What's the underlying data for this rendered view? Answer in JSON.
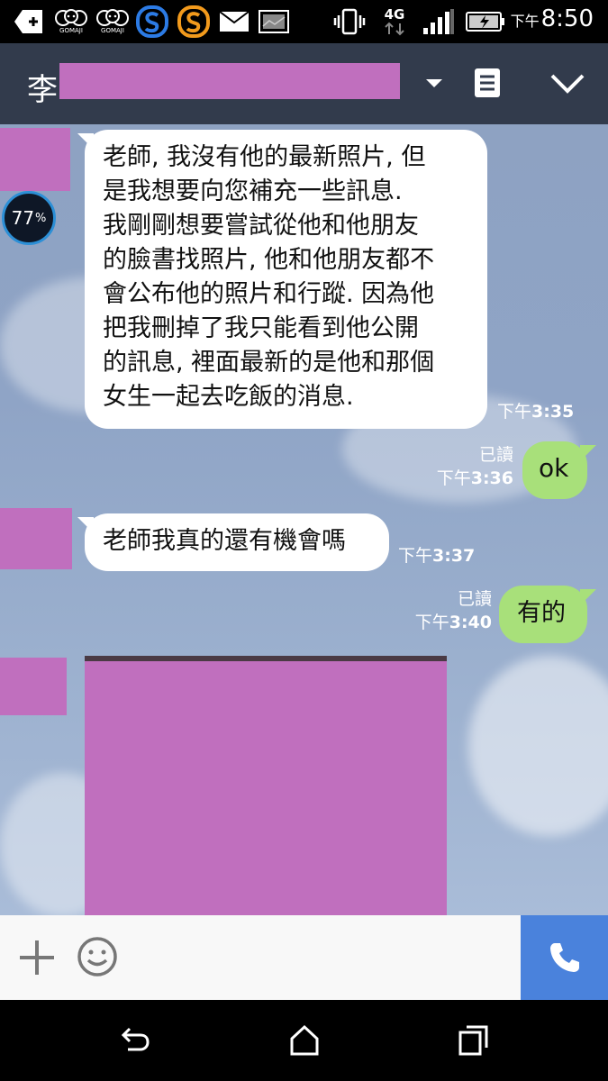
{
  "status_bar": {
    "time": "8:50",
    "ampm": "下午",
    "network": "4G",
    "icons": [
      "add-icon",
      "gomaji-icon",
      "gomaji-icon",
      "s-app-icon",
      "s-app-icon",
      "mail-icon",
      "image-icon",
      "vibrate-icon",
      "signal-icon",
      "battery-charging-icon"
    ],
    "gomaji_label": "GOMAJI"
  },
  "header": {
    "title": "李",
    "icons": [
      "dropdown-icon",
      "notes-icon",
      "chevron-down-icon"
    ]
  },
  "contact_badge": {
    "value": "77",
    "unit": "%"
  },
  "messages": [
    {
      "direction": "in",
      "lines": [
        "老師, 我沒有他的最新照片, 但",
        "是我想要向您補充一些訊息.",
        "我剛剛想要嘗試從他和他朋友",
        "的臉書找照片, 他和他朋友都不",
        "會公布他的照片和行蹤. 因為他",
        "把我刪掉了我只能看到他公開",
        "的訊息, 裡面最新的是他和那個",
        "女生一起去吃飯的消息."
      ],
      "ampm": "下午",
      "time": "3:35"
    },
    {
      "direction": "out",
      "text": "ok",
      "read": "已讀",
      "ampm": "下午",
      "time": "3:36"
    },
    {
      "direction": "in",
      "text": "老師我真的還有機會嗎",
      "ampm": "下午",
      "time": "3:37"
    },
    {
      "direction": "out",
      "text": "有的",
      "read": "已讀",
      "ampm": "下午",
      "time": "3:40"
    }
  ],
  "colors": {
    "header_bg": "#323b4c",
    "out_bubble": "#a8e07a",
    "call_button": "#4a82dc",
    "redaction": "#c06fbe"
  },
  "input_bar": {
    "icons": [
      "plus-icon",
      "emoji-icon",
      "phone-icon"
    ]
  },
  "nav_bar": {
    "icons": [
      "back-icon",
      "home-icon",
      "recents-icon"
    ]
  }
}
